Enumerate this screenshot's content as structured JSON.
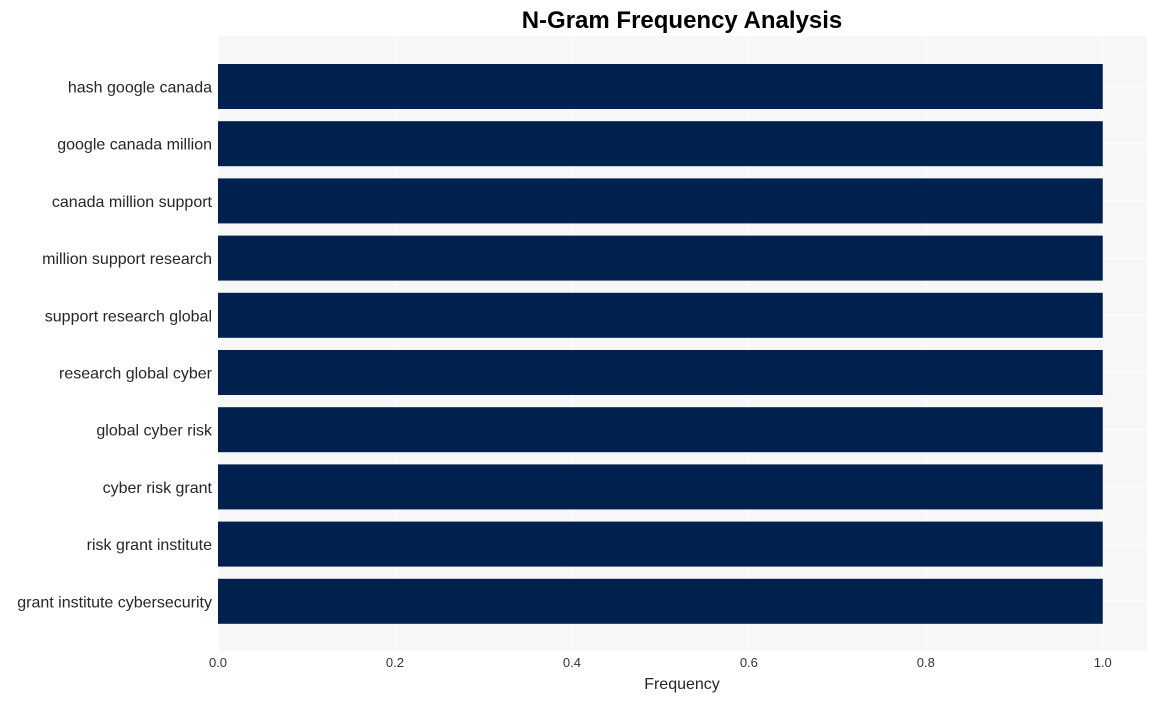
{
  "chart_data": {
    "type": "bar",
    "orientation": "horizontal",
    "title": "N-Gram Frequency Analysis",
    "xlabel": "Frequency",
    "ylabel": "",
    "categories": [
      "hash google canada",
      "google canada million",
      "canada million support",
      "million support research",
      "support research global",
      "research global cyber",
      "global cyber risk",
      "cyber risk grant",
      "risk grant institute",
      "grant institute cybersecurity"
    ],
    "values": [
      1,
      1,
      1,
      1,
      1,
      1,
      1,
      1,
      1,
      1
    ],
    "xlim": [
      0,
      1.05
    ],
    "xticks": [
      0.0,
      0.2,
      0.4,
      0.6,
      0.8,
      1.0
    ],
    "xtick_labels": [
      "0.0",
      "0.2",
      "0.4",
      "0.6",
      "0.8",
      "1.0"
    ],
    "grid": true,
    "legend": "none",
    "colors": {
      "bar": "#00214e",
      "plot_background": "#f7f7f7",
      "grid": "#ffffff"
    }
  }
}
